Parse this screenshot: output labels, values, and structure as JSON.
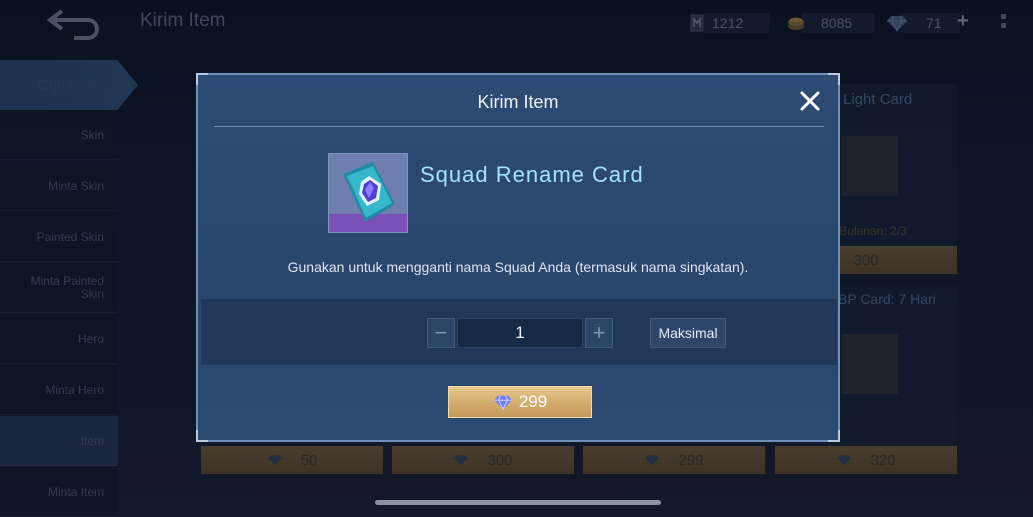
{
  "header": {
    "title": "Kirim Item",
    "resources": [
      {
        "icon": "battle-point-icon",
        "value": "1212"
      },
      {
        "icon": "coin-icon",
        "value": "8085"
      },
      {
        "icon": "diamond-icon",
        "value": "71"
      }
    ],
    "add_label": "+"
  },
  "sidebar": {
    "category": "Common",
    "items": [
      {
        "label": "Skin"
      },
      {
        "label": "Minta Skin"
      },
      {
        "label": "Painted Skin"
      },
      {
        "label": "Minta Painted Skin"
      },
      {
        "label": "Hero"
      },
      {
        "label": "Minta Hero"
      },
      {
        "label": "Item"
      },
      {
        "label": "Minta Item"
      }
    ],
    "active_index": 6
  },
  "background": {
    "card_title_fragment": "Light Card",
    "limit_fragment": "s Bulanan: 2/3",
    "price_fragment": "300",
    "card2_title_fragment": "BP Card: 7 Hari",
    "prices": [
      "50",
      "300",
      "299",
      "320"
    ]
  },
  "modal": {
    "title": "Kirim Item",
    "item_name": "Squad Rename Card",
    "description": "Gunakan untuk mengganti nama Squad Anda (termasuk nama singkatan).",
    "quantity": "1",
    "minus_label": "−",
    "plus_label": "+",
    "max_label": "Maksimal",
    "price": "299",
    "price_icon": "diamond-icon"
  },
  "colors": {
    "modal_bg": "#2c4a73",
    "accent_text": "#a4e3ff",
    "buy_button": "#d2ac6c"
  }
}
